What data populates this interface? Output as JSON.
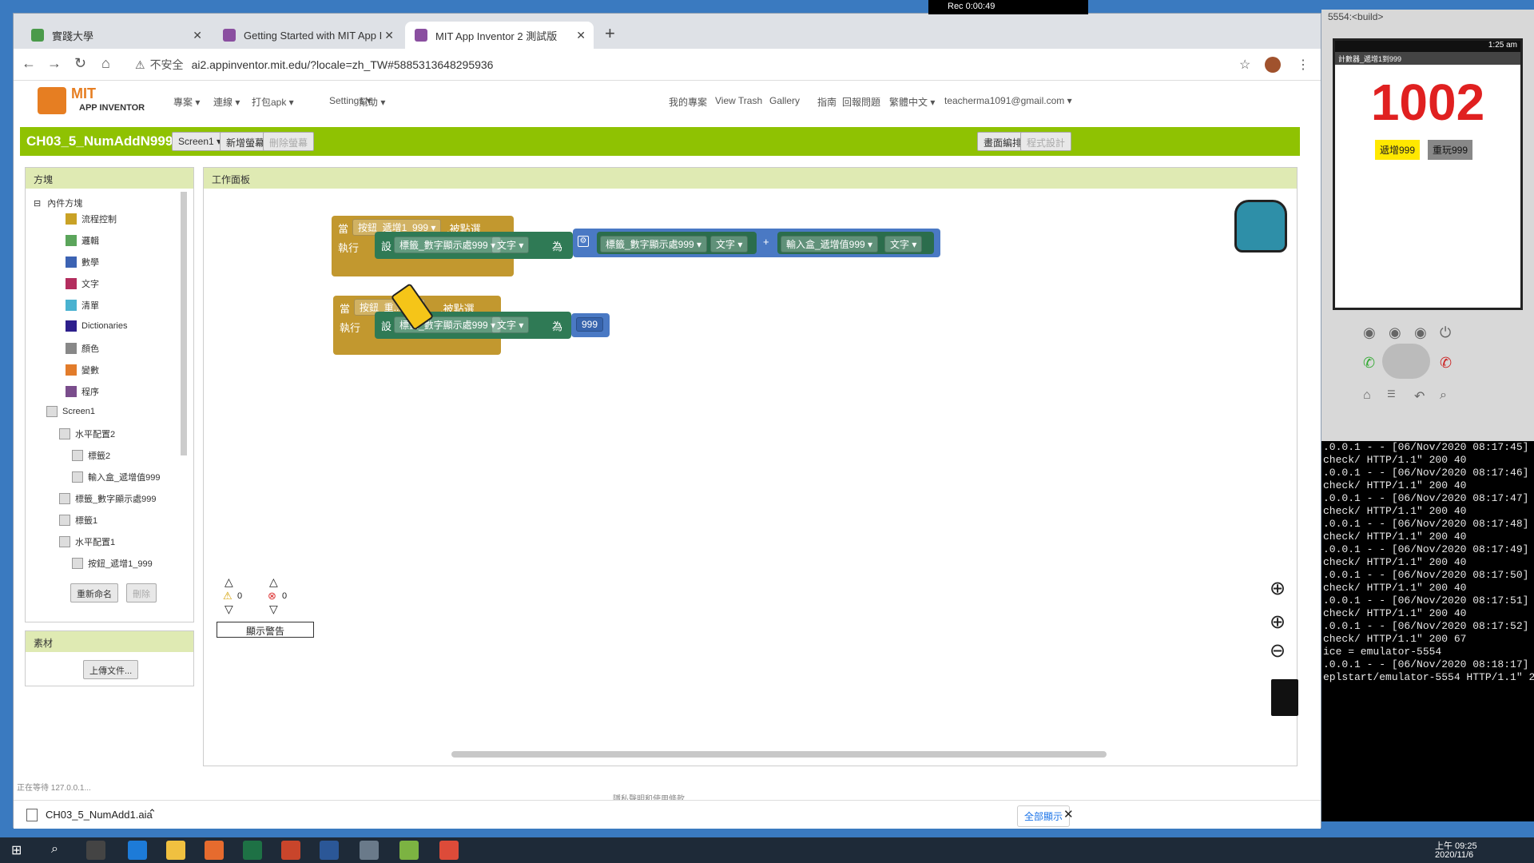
{
  "tabs": [
    {
      "label": "實踐大學"
    },
    {
      "label": "Getting Started with MIT App I"
    },
    {
      "label": "MIT App Inventor 2 測試版"
    }
  ],
  "new_tab": "+",
  "address": {
    "security": "不安全",
    "url": "ai2.appinventor.mit.edu/?locale=zh_TW#5885313648295936"
  },
  "rec": "Rec 0:00:49",
  "mit": {
    "logo_top": "MIT",
    "logo_bottom": "APP INVENTOR",
    "menus": [
      "專案 ▾",
      "連線 ▾",
      "打包apk ▾",
      "Settings ▾",
      "幫助 ▾"
    ],
    "right_menus": [
      "我的專案",
      "View Trash",
      "Gallery",
      "指南",
      "回報問題",
      "繁體中文 ▾",
      "teacherma1091@gmail.com ▾"
    ]
  },
  "project": {
    "title": "CH03_5_NumAddN999",
    "screen": "Screen1 ▾",
    "add_screen": "新增螢幕",
    "remove_screen": "刪除螢幕",
    "designer": "畫面編排",
    "blocks": "程式設計"
  },
  "blocks_panel": {
    "title": "方塊",
    "builtin": "內件方塊",
    "categories": [
      {
        "label": "流程控制",
        "color": "#c9a226"
      },
      {
        "label": "邏輯",
        "color": "#5ba55b"
      },
      {
        "label": "數學",
        "color": "#3c63b3"
      },
      {
        "label": "文字",
        "color": "#b32d5e"
      },
      {
        "label": "清單",
        "color": "#4ab2d0"
      },
      {
        "label": "Dictionaries",
        "color": "#2d1f8c"
      },
      {
        "label": "顏色",
        "color": "#888888"
      },
      {
        "label": "變數",
        "color": "#e27c2b"
      },
      {
        "label": "程序",
        "color": "#7a4d8c"
      }
    ],
    "components": [
      "Screen1",
      "水平配置2",
      "標籤2",
      "輸入盒_遞增值999",
      "標籤_數字顯示處999",
      "標籤1",
      "水平配置1",
      "按鈕_遞增1_999"
    ],
    "rename": "重新命名",
    "delete": "刪除"
  },
  "assets": {
    "title": "素材",
    "upload": "上傳文件..."
  },
  "workspace": {
    "title": "工作面板",
    "event1": {
      "when": "當",
      "component": "按鈕_遞增1_999 ▾",
      "event": ".被點選",
      "do": "執行",
      "set": "設",
      "target": "標籤_數字顯示處999 ▾",
      "prop": "文字 ▾",
      "to": "為",
      "op": "+",
      "arg1": "標籤_數字顯示處999 ▾",
      "arg1prop": "文字 ▾",
      "arg2": "輸入盒_遞增值999 ▾",
      "arg2prop": "文字 ▾"
    },
    "event2": {
      "when": "當",
      "component": "按鈕_重...99 ▾",
      "event": ".被點選",
      "do": "執行",
      "set": "設",
      "target": "標籤_數字顯示處999 ▾",
      "prop": "文字 ▾",
      "to": "為",
      "value": "999"
    },
    "warnings": "0",
    "errors": "0",
    "show_warnings": "顯示警告"
  },
  "status": "正在等待 127.0.0.1...",
  "footer": "隱私聲明和使用條款",
  "emulator": {
    "title": "5554:<build>",
    "time": "1:25 am",
    "app_title": "計數器_遞增1到999",
    "number": "1002",
    "btn1": "遞增999",
    "btn2": "重玩999"
  },
  "console": [
    ".0.0.1 - - [06/Nov/2020 08:17:45]",
    "check/ HTTP/1.1\" 200 40",
    ".0.0.1 - - [06/Nov/2020 08:17:46]",
    "check/ HTTP/1.1\" 200 40",
    ".0.0.1 - - [06/Nov/2020 08:17:47]",
    "check/ HTTP/1.1\" 200 40",
    ".0.0.1 - - [06/Nov/2020 08:17:48]",
    "check/ HTTP/1.1\" 200 40",
    ".0.0.1 - - [06/Nov/2020 08:17:49]",
    "check/ HTTP/1.1\" 200 40",
    ".0.0.1 - - [06/Nov/2020 08:17:50]",
    "check/ HTTP/1.1\" 200 40",
    ".0.0.1 - - [06/Nov/2020 08:17:51]",
    "check/ HTTP/1.1\" 200 40",
    ".0.0.1 - - [06/Nov/2020 08:17:52]",
    "check/ HTTP/1.1\" 200 67",
    "ice = emulator-5554",
    ".0.0.1 - - [06/Nov/2020 08:18:17]",
    "eplstart/emulator-5554 HTTP/1.1\" 2"
  ],
  "download": {
    "file": "CH03_5_NumAdd1.aia",
    "show_all": "全部顯示"
  },
  "taskbar": {
    "time": "上午 09:25",
    "date": "2020/11/6"
  }
}
